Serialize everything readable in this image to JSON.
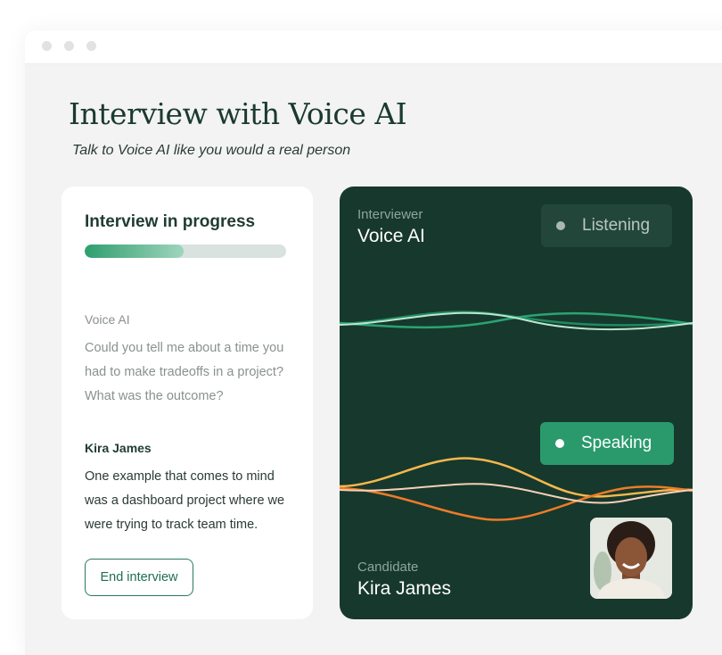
{
  "page": {
    "title": "Interview with Voice AI",
    "subtitle": "Talk to Voice AI like you would a real person"
  },
  "transcript": {
    "heading": "Interview in progress",
    "progress": 0.49,
    "messages": [
      {
        "speaker": "Voice AI",
        "text": "Could you tell me about a time you had to make tradeoffs in a project? What was the outcome?"
      },
      {
        "speaker": "Kira James",
        "text": "One example that comes to mind was a dashboard project where we were trying to track team time."
      }
    ],
    "end_button_label": "End interview"
  },
  "interviewer": {
    "role_label": "Interviewer",
    "name": "Voice AI",
    "status": "Listening"
  },
  "candidate": {
    "role_label": "Candidate",
    "name": "Kira James",
    "status": "Speaking"
  },
  "colors": {
    "panel_bg": "#17382d",
    "accent_green": "#2a9a6d",
    "wave_orange": "#f0872f",
    "wave_yellow": "#f5b84c"
  }
}
